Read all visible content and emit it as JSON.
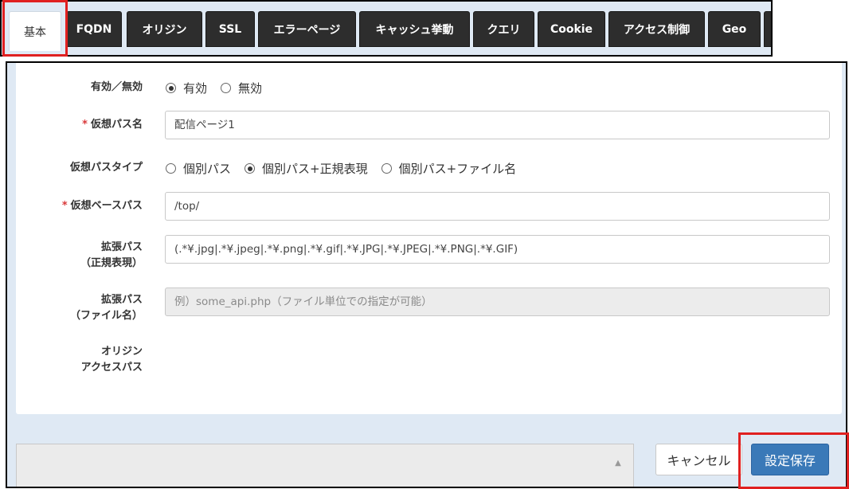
{
  "tabs": [
    {
      "label": "基本",
      "active": true
    },
    {
      "label": "FQDN",
      "active": false
    },
    {
      "label": "オリジン",
      "active": false
    },
    {
      "label": "SSL",
      "active": false
    },
    {
      "label": "エラーページ",
      "active": false
    },
    {
      "label": "キャッシュ挙動",
      "active": false
    },
    {
      "label": "クエリ",
      "active": false
    },
    {
      "label": "Cookie",
      "active": false
    },
    {
      "label": "アクセス制御",
      "active": false
    },
    {
      "label": "Geo",
      "active": false
    }
  ],
  "form": {
    "enabled": {
      "label": "有効／無効",
      "options": [
        {
          "label": "有効",
          "checked": true
        },
        {
          "label": "無効",
          "checked": false
        }
      ]
    },
    "virtual_path_name": {
      "required_mark": "*",
      "label": "仮想パス名",
      "value": "配信ページ1"
    },
    "virtual_path_type": {
      "label": "仮想パスタイプ",
      "options": [
        {
          "label": "個別パス",
          "checked": false
        },
        {
          "label": "個別パス+正規表現",
          "checked": true
        },
        {
          "label": "個別パス+ファイル名",
          "checked": false
        }
      ]
    },
    "virtual_base_path": {
      "required_mark": "*",
      "label": "仮想ベースパス",
      "value": "/top/"
    },
    "ext_path_regex": {
      "label_line1": "拡張パス",
      "label_line2": "（正規表現）",
      "value": "(.*¥.jpg|.*¥.jpeg|.*¥.png|.*¥.gif|.*¥.JPG|.*¥.JPEG|.*¥.PNG|.*¥.GIF)"
    },
    "ext_path_file": {
      "label_line1": "拡張パス",
      "label_line2": "（ファイル名）",
      "placeholder": "例）some_api.php（ファイル単位での指定が可能）"
    },
    "origin_access_path": {
      "label_line1": "オリジン",
      "label_line2": "アクセスパス"
    }
  },
  "buttons": {
    "cancel": "キャンセル",
    "save": "設定保存"
  },
  "colors": {
    "highlight": "#e02020",
    "primary_button": "#3a79b8",
    "tab_dark": "#2d2d2d",
    "panel_bg": "#dfe9f4"
  }
}
